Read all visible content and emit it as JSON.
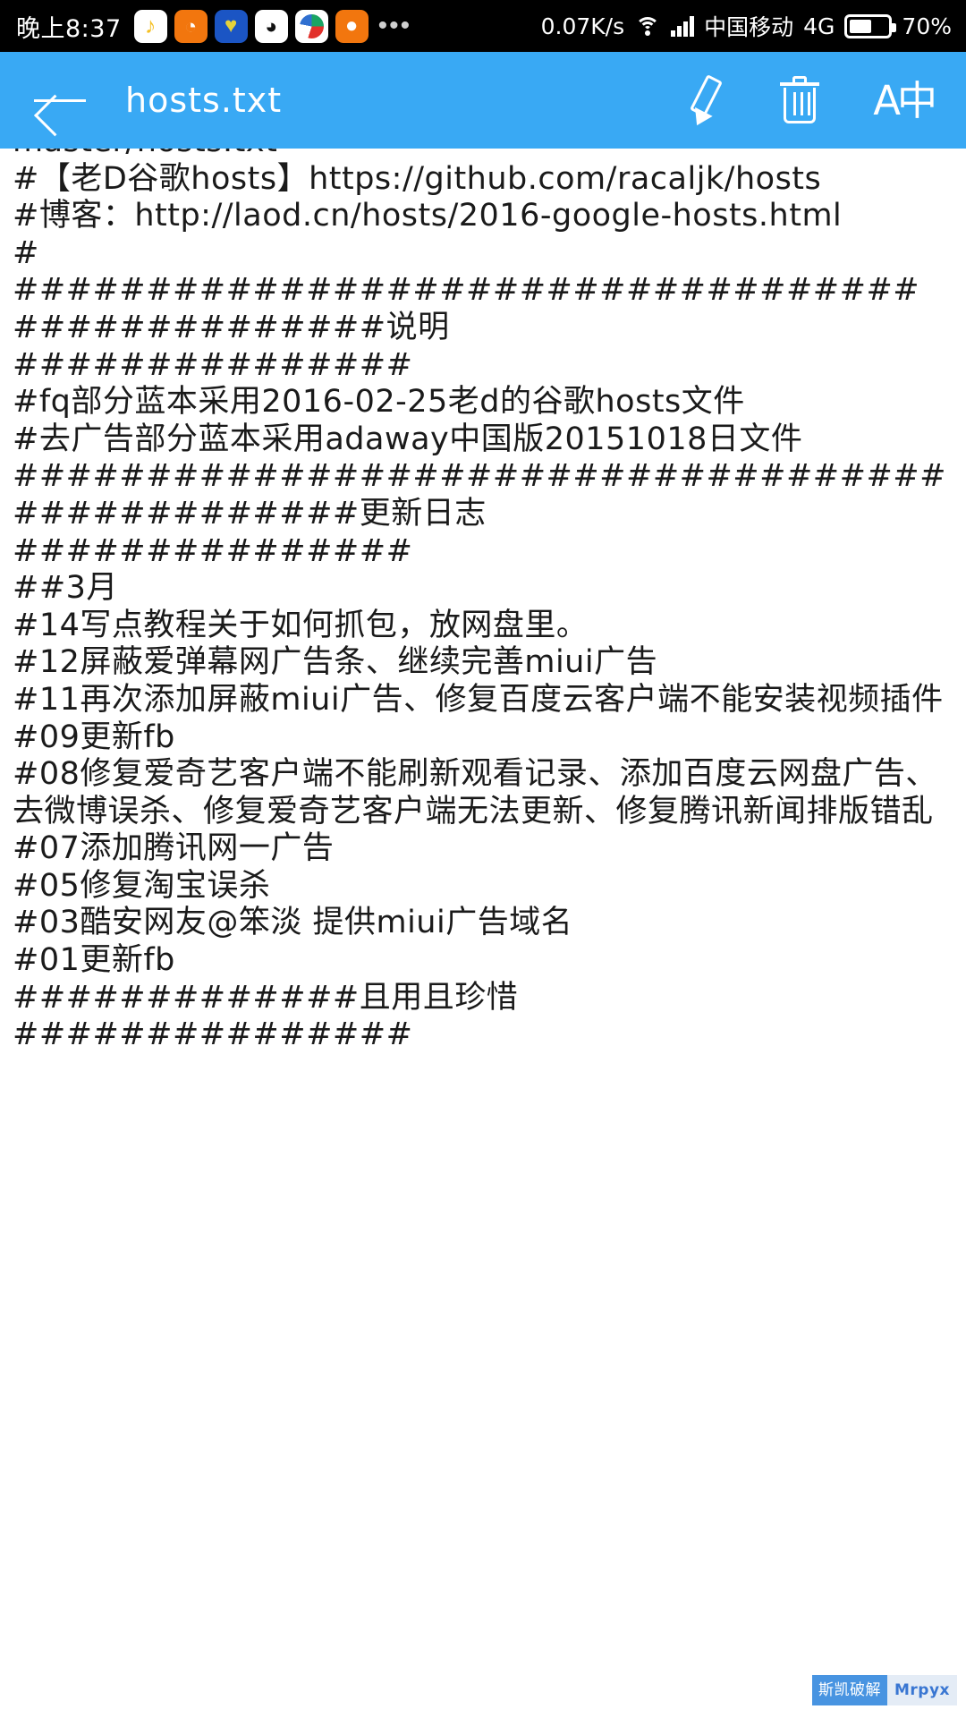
{
  "status_bar": {
    "clock": "晚上8:37",
    "network_speed": "0.07K/s",
    "carrier": "中国移动",
    "network_type": "4G",
    "battery_percent": "70%",
    "overflow_dots": "•••",
    "app_icons": [
      {
        "name": "qq-music-icon",
        "glyph": "♪"
      },
      {
        "name": "uc-browser-icon",
        "glyph": "◔"
      },
      {
        "name": "shield-app-icon",
        "glyph": "♥"
      },
      {
        "name": "qq-icon",
        "glyph": "◕"
      },
      {
        "name": "browser-icon",
        "glyph": ""
      },
      {
        "name": "chat-app-icon",
        "glyph": "●"
      }
    ],
    "colors": {
      "background": "#000000",
      "text": "#ffffff"
    }
  },
  "app_bar": {
    "title": "hosts.txt",
    "background": "#39a9f4",
    "back_label": "back",
    "actions": [
      {
        "name": "edit-icon",
        "label": "编辑"
      },
      {
        "name": "delete-icon",
        "label": "删除"
      },
      {
        "name": "encoding-icon",
        "label": "A中"
      }
    ]
  },
  "document": {
    "filename": "hosts.txt",
    "content": "master/hosts.txt\n#【老D谷歌hosts】https://github.com/racaljk/hosts\n#博客：http://laod.cn/hosts/2016-google-hosts.html\n#\n##################################\n##############说明\n###############\n#fq部分蓝本采用2016-02-25老d的谷歌hosts文件\n#去广告部分蓝本采用adaway中国版20151018日文件\n###################################\n#############更新日志\n###############\n##3月\n#14写点教程关于如何抓包，放网盘里。\n#12屏蔽爱弹幕网广告条、继续完善miui广告\n#11再次添加屏蔽miui广告、修复百度云客户端不能安装视频插件\n#09更新fb\n#08修复爱奇艺客户端不能刷新观看记录、添加百度云网盘广告、去微博误杀、修复爱奇艺客户端无法更新、修复腾讯新闻排版错乱\n#07添加腾讯网一广告\n#05修复淘宝误杀\n#03酷安网友@笨淡 提供miui广告域名\n#01更新fb\n#############且用且珍惜\n###############"
  },
  "watermark": {
    "left_text": "斯凯破解",
    "right_text": "Mrpyx"
  }
}
